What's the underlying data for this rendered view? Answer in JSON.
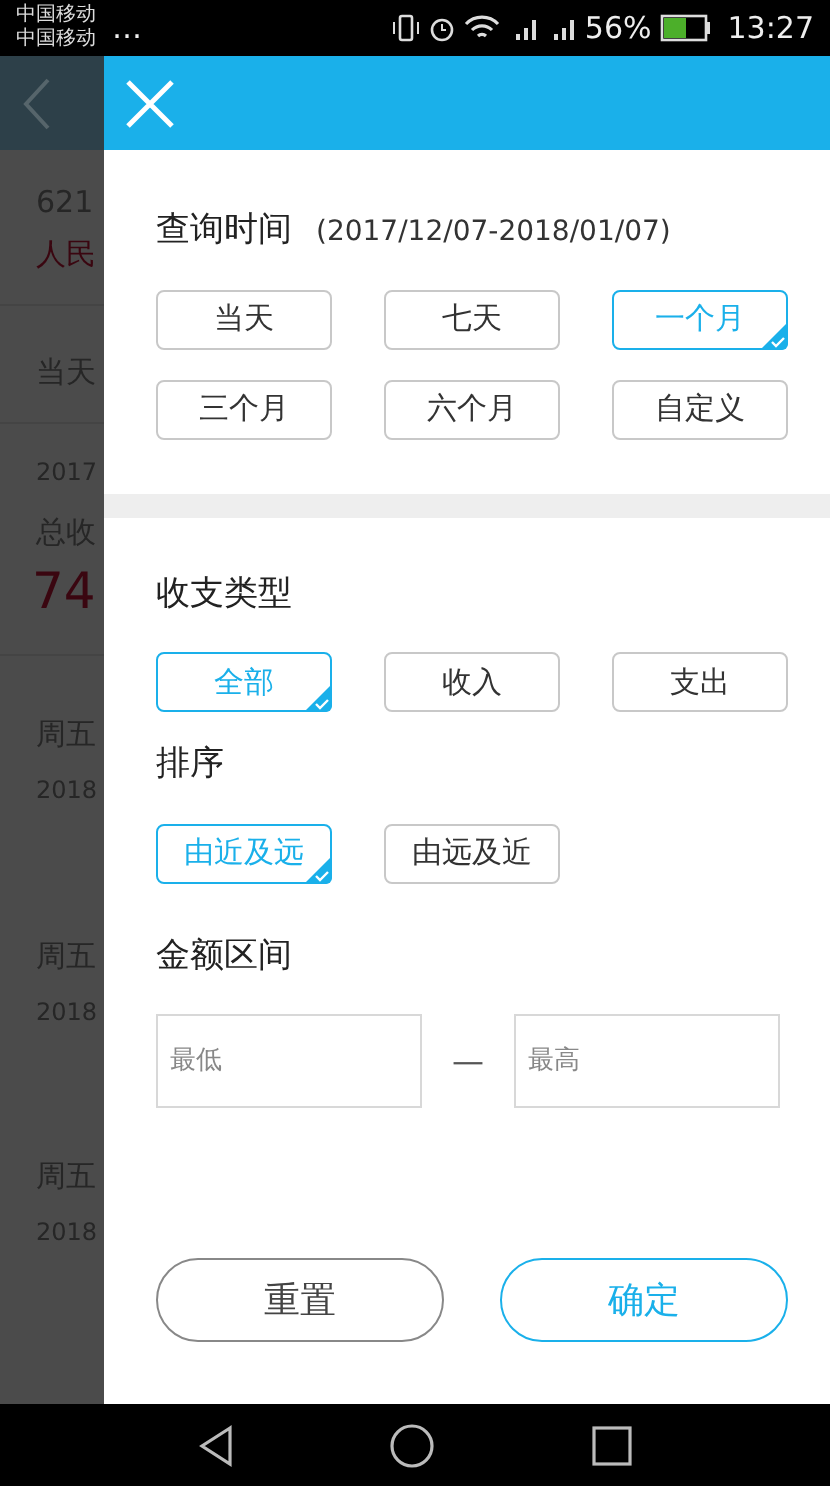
{
  "status_bar": {
    "carriers": [
      "中国移动",
      "中国移动"
    ],
    "more": "…",
    "battery": "56%",
    "time": "13:27"
  },
  "background": {
    "account_number": "621",
    "currency": "人民",
    "period": "当天",
    "summary_date": "2017",
    "summary_label": "总收",
    "summary_amount": "74",
    "records": [
      {
        "day": "周五",
        "date": "2018"
      },
      {
        "day": "周五",
        "date": "2018"
      },
      {
        "day": "周五",
        "date": "2018"
      }
    ]
  },
  "filter_panel": {
    "sections": [
      {
        "kind": "options",
        "title": "查询时间",
        "note": "(2017/12/07-2018/01/07)",
        "options": [
          {
            "label": "当天",
            "selected": false
          },
          {
            "label": "七天",
            "selected": false
          },
          {
            "label": "一个月",
            "selected": true
          },
          {
            "label": "三个月",
            "selected": false
          },
          {
            "label": "六个月",
            "selected": false
          },
          {
            "label": "自定义",
            "selected": false
          }
        ]
      },
      {
        "kind": "options",
        "title": "收支类型",
        "options": [
          {
            "label": "全部",
            "selected": true
          },
          {
            "label": "收入",
            "selected": false
          },
          {
            "label": "支出",
            "selected": false
          }
        ]
      },
      {
        "kind": "options",
        "title": "排序",
        "options": [
          {
            "label": "由近及远",
            "selected": true
          },
          {
            "label": "由远及近",
            "selected": false
          }
        ]
      },
      {
        "kind": "range",
        "title": "金额区间",
        "min_placeholder": "最低",
        "separator": "—",
        "max_placeholder": "最高"
      }
    ],
    "reset": "重置",
    "confirm": "确定"
  }
}
